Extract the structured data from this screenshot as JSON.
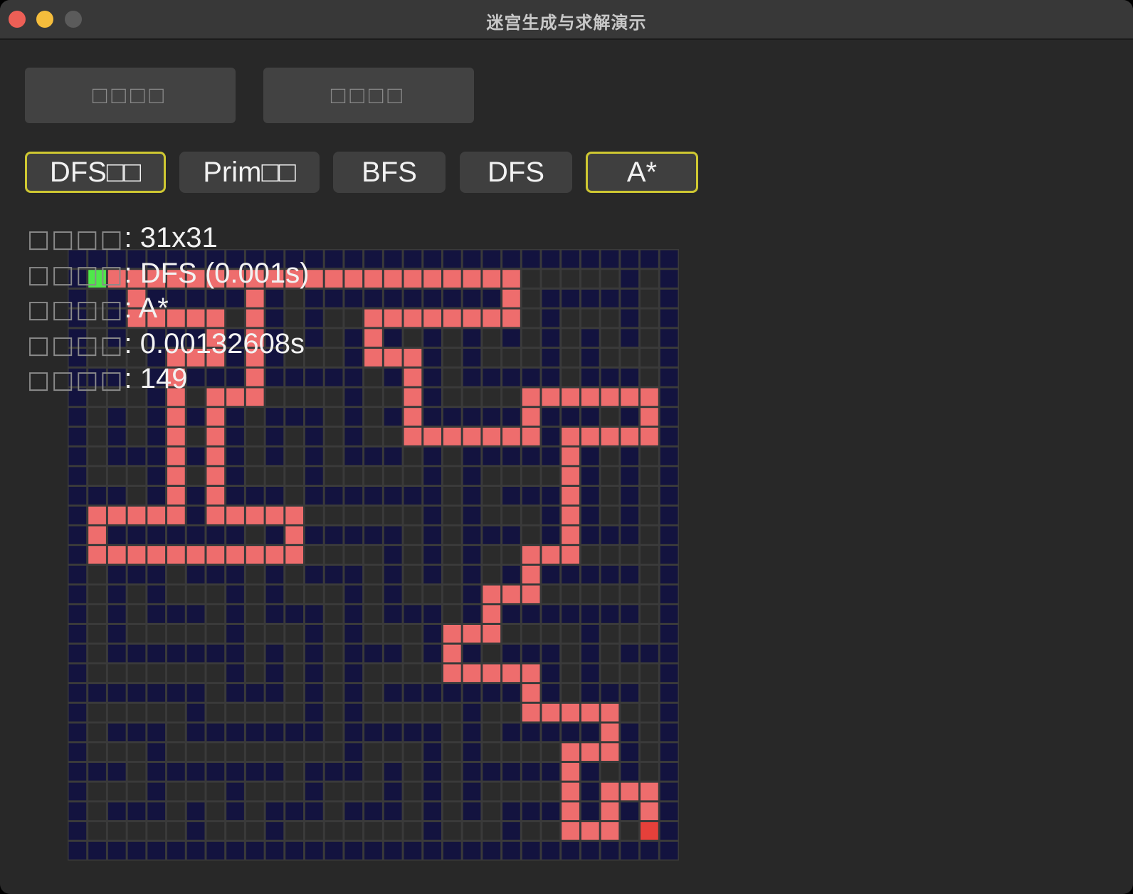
{
  "window": {
    "title": "迷宫生成与求解演示"
  },
  "actions": {
    "generate_label": "□□□□",
    "solve_label": "□□□□"
  },
  "algorithms": [
    {
      "label": "DFS□□",
      "active": true
    },
    {
      "label": "Prim□□",
      "active": false
    },
    {
      "label": "BFS",
      "active": false
    },
    {
      "label": "DFS",
      "active": false
    },
    {
      "label": "A*",
      "active": true
    }
  ],
  "stats": [
    {
      "label": "□□□□",
      "value": ": 31x31"
    },
    {
      "label": "□□□□",
      "value": ": DFS (0.001s)"
    },
    {
      "label": "□□□□",
      "value": ": A*"
    },
    {
      "label": "□□□□",
      "value": ": 0.00132608s"
    },
    {
      "label": "□□□□",
      "value": ": 149"
    }
  ],
  "colors": {
    "wall": "#13133f",
    "open": "#2b2b2b",
    "path": "#ee6d6d",
    "start": "#4fe84a",
    "end": "#e6403a",
    "grid_line": "#3a3a3a",
    "active_border": "#cfc832"
  },
  "maze": {
    "size": 31,
    "start": [
      1,
      1
    ],
    "end": [
      29,
      29
    ],
    "walls": [
      "###############################",
      "#...........................#.#",
      "#.#########.###########.#####.#",
      "#.#...#...#.#.....#...#.#...#.#",
      "#.#.###.#.#.#.###.#.#.#.#.#.#.#",
      "#...#...#.#...#...#.#...#.#...#",
      "###.#.#########.###.#####.###.#",
      "#...#...#.....#...#.........#.#",
      "#.#.###.#.###.#.#######.###.###",
      "#.#.#...#.#.#.#...#.....#.#...#",
      "#.###.###.#.#.###.#.#####.#.#.#",
      "#...#...#...#.....#.#.....#.#.#",
      "###.###.###.#######.#.###.#.#.#",
      "#.....#...#.......#.#...#.#.#.#",
      "#.#######.#######.#.###.#.###.#",
      "#.........#.....#.#.#...#.....#",
      "#.###.###.#.###.#.#.#.#######.#",
      "#.#.#...#.#...#.#...#.........#",
      "#.#.###.#.###.#.###.#########.#",
      "#.#.....#...#.#...#.#.....#...#",
      "#.#######.#.#.###.#.#.###.#.###",
      "#.......#.#.#.#.....#...#.#...#",
      "#######.###.#.#.#######.#.###.#",
      "#.....#.....#.#.....#...#.....#",
      "#.###.#######.#####.#.#######.#",
      "#...#.........#...#.#.......#.#",
      "###.#######.###.#.#.#######.#.#",
      "#...#...#...#...#.#.#.....#...#",
      "#.###.#.#.###.###.#.#.###.#.###",
      "#.....#...#.......#...#.......#",
      "###############################"
    ],
    "path_cells": [
      [
        1,
        1
      ],
      [
        2,
        1
      ],
      [
        3,
        1
      ],
      [
        4,
        1
      ],
      [
        5,
        1
      ],
      [
        6,
        1
      ],
      [
        7,
        1
      ],
      [
        8,
        1
      ],
      [
        9,
        1
      ],
      [
        10,
        1
      ],
      [
        11,
        1
      ],
      [
        12,
        1
      ],
      [
        13,
        1
      ],
      [
        14,
        1
      ],
      [
        15,
        1
      ],
      [
        16,
        1
      ],
      [
        17,
        1
      ],
      [
        18,
        1
      ],
      [
        19,
        1
      ],
      [
        20,
        1
      ],
      [
        21,
        1
      ],
      [
        22,
        1
      ],
      [
        22,
        2
      ],
      [
        22,
        3
      ],
      [
        21,
        3
      ],
      [
        20,
        3
      ],
      [
        19,
        3
      ],
      [
        18,
        3
      ],
      [
        17,
        3
      ],
      [
        16,
        3
      ],
      [
        15,
        3
      ],
      [
        15,
        4
      ],
      [
        15,
        5
      ],
      [
        16,
        5
      ],
      [
        17,
        5
      ],
      [
        17,
        6
      ],
      [
        17,
        7
      ],
      [
        17,
        8
      ],
      [
        17,
        9
      ],
      [
        18,
        9
      ],
      [
        19,
        9
      ],
      [
        20,
        9
      ],
      [
        21,
        9
      ],
      [
        22,
        9
      ],
      [
        23,
        9
      ],
      [
        23,
        8
      ],
      [
        23,
        7
      ],
      [
        24,
        7
      ],
      [
        25,
        7
      ],
      [
        26,
        7
      ],
      [
        27,
        7
      ],
      [
        28,
        7
      ],
      [
        29,
        7
      ],
      [
        29,
        8
      ],
      [
        29,
        9
      ],
      [
        28,
        9
      ],
      [
        27,
        9
      ],
      [
        26,
        9
      ],
      [
        25,
        9
      ],
      [
        25,
        10
      ],
      [
        25,
        11
      ],
      [
        25,
        12
      ],
      [
        25,
        13
      ],
      [
        25,
        14
      ],
      [
        25,
        15
      ],
      [
        24,
        15
      ],
      [
        23,
        15
      ],
      [
        23,
        16
      ],
      [
        23,
        17
      ],
      [
        22,
        17
      ],
      [
        21,
        17
      ],
      [
        21,
        18
      ],
      [
        21,
        19
      ],
      [
        20,
        19
      ],
      [
        19,
        19
      ],
      [
        19,
        20
      ],
      [
        19,
        21
      ],
      [
        20,
        21
      ],
      [
        21,
        21
      ],
      [
        22,
        21
      ],
      [
        23,
        21
      ],
      [
        23,
        22
      ],
      [
        23,
        23
      ],
      [
        24,
        23
      ],
      [
        25,
        23
      ],
      [
        26,
        23
      ],
      [
        27,
        23
      ],
      [
        27,
        24
      ],
      [
        27,
        25
      ],
      [
        26,
        25
      ],
      [
        25,
        25
      ],
      [
        25,
        26
      ],
      [
        25,
        27
      ],
      [
        25,
        28
      ],
      [
        25,
        29
      ],
      [
        26,
        29
      ],
      [
        27,
        29
      ],
      [
        27,
        28
      ],
      [
        27,
        27
      ],
      [
        28,
        27
      ],
      [
        29,
        27
      ],
      [
        29,
        28
      ],
      [
        3,
        2
      ],
      [
        3,
        3
      ],
      [
        4,
        3
      ],
      [
        5,
        3
      ],
      [
        6,
        3
      ],
      [
        7,
        3
      ],
      [
        7,
        4
      ],
      [
        7,
        5
      ],
      [
        6,
        5
      ],
      [
        5,
        5
      ],
      [
        5,
        6
      ],
      [
        5,
        7
      ],
      [
        5,
        8
      ],
      [
        5,
        9
      ],
      [
        5,
        10
      ],
      [
        5,
        11
      ],
      [
        5,
        12
      ],
      [
        5,
        13
      ],
      [
        4,
        13
      ],
      [
        3,
        13
      ],
      [
        2,
        13
      ],
      [
        1,
        13
      ],
      [
        1,
        14
      ],
      [
        1,
        15
      ],
      [
        2,
        15
      ],
      [
        3,
        15
      ],
      [
        4,
        15
      ],
      [
        5,
        15
      ],
      [
        6,
        15
      ],
      [
        7,
        15
      ],
      [
        8,
        15
      ],
      [
        9,
        15
      ],
      [
        10,
        15
      ],
      [
        11,
        15
      ],
      [
        11,
        14
      ],
      [
        11,
        13
      ],
      [
        10,
        13
      ],
      [
        9,
        13
      ],
      [
        8,
        13
      ],
      [
        7,
        13
      ],
      [
        7,
        12
      ],
      [
        7,
        11
      ],
      [
        7,
        10
      ],
      [
        7,
        9
      ],
      [
        7,
        8
      ],
      [
        7,
        7
      ],
      [
        8,
        7
      ],
      [
        9,
        7
      ],
      [
        9,
        6
      ],
      [
        9,
        5
      ],
      [
        9,
        4
      ],
      [
        9,
        3
      ],
      [
        9,
        2
      ]
    ]
  }
}
